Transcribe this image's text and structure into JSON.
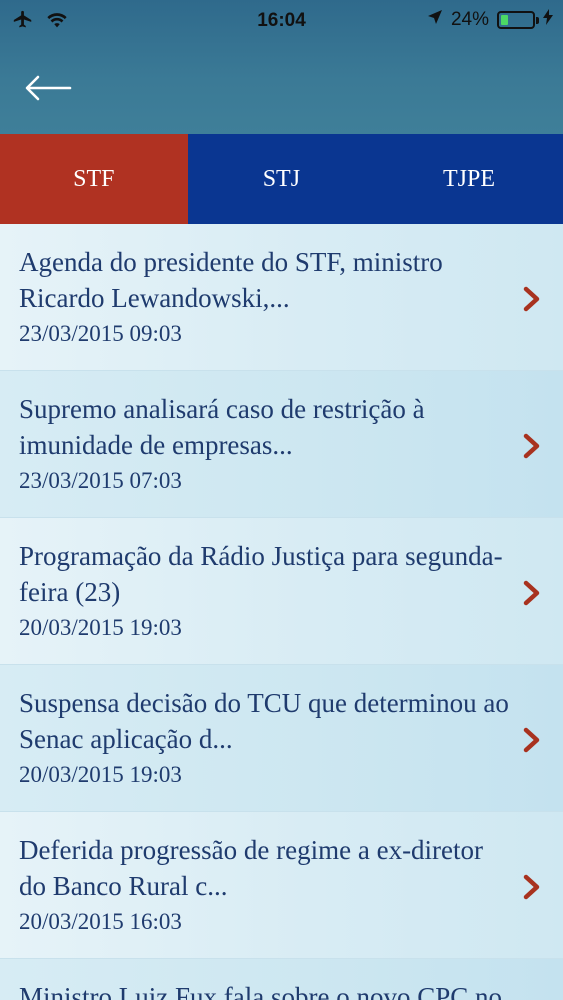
{
  "status_bar": {
    "time": "16:04",
    "battery": "24%",
    "battery_level": 0.24
  },
  "tabs": [
    {
      "label": "STF",
      "active": true
    },
    {
      "label": "STJ",
      "active": false
    },
    {
      "label": "TJPE",
      "active": false
    }
  ],
  "news": [
    {
      "title": "Agenda do presidente do STF, ministro Ricardo Lewandowski,...",
      "date": "23/03/2015 09:03"
    },
    {
      "title": "Supremo analisará caso de restrição à imunidade de empresas...",
      "date": "23/03/2015 07:03"
    },
    {
      "title": "Programação da Rádio Justiça para segunda-feira (23)",
      "date": "20/03/2015 19:03"
    },
    {
      "title": "Suspensa decisão do TCU que determinou ao Senac aplicação d...",
      "date": "20/03/2015 19:03"
    },
    {
      "title": "Deferida progressão de regime a ex-diretor do Banco Rural c...",
      "date": "20/03/2015 16:03"
    },
    {
      "title": "Ministro Luiz Fux fala sobre o novo CPC no",
      "date": ""
    }
  ],
  "colors": {
    "header": "#3b7a96",
    "tab_active": "#b03222",
    "tab_bar": "#0a3691",
    "text": "#1f3b6e",
    "chevron": "#a8321f"
  }
}
